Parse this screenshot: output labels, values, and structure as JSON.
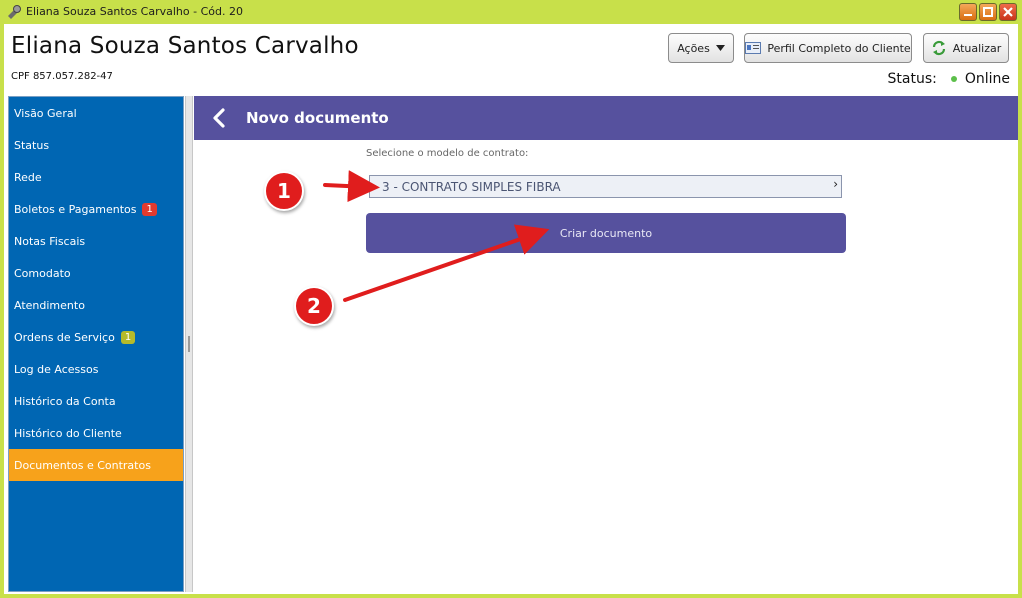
{
  "window": {
    "title": "Eliana Souza Santos Carvalho - Cód. 20",
    "icon": "app-icon",
    "controls": [
      "minimize-icon",
      "maximize-icon",
      "close-icon"
    ]
  },
  "header": {
    "client_name": "Eliana Souza Santos Carvalho",
    "cpf": "CPF 857.057.282-47",
    "actions_label": "Ações",
    "profile_label": "Perfil Completo do Cliente",
    "refresh_label": "Atualizar",
    "status_label": "Status:",
    "status_value": "Online",
    "status_color": "#5cbf4a"
  },
  "sidebar": {
    "items": [
      {
        "label": "Visão Geral"
      },
      {
        "label": "Status"
      },
      {
        "label": "Rede"
      },
      {
        "label": "Boletos e Pagamentos",
        "badge": "1",
        "badge_color": "#e23a2e"
      },
      {
        "label": "Notas Fiscais"
      },
      {
        "label": "Comodato"
      },
      {
        "label": "Atendimento"
      },
      {
        "label": "Ordens de Serviço",
        "badge": "1",
        "badge_color": "#b5ba2a"
      },
      {
        "label": "Log de Acessos"
      },
      {
        "label": "Histórico da Conta"
      },
      {
        "label": "Histórico do Cliente"
      },
      {
        "label": "Documentos e Contratos",
        "active": true
      }
    ],
    "background": "#0066b3",
    "active_color": "#f7a21b"
  },
  "main": {
    "title": "Novo documento",
    "select_label": "Selecione o modelo de contrato:",
    "selected_contract": "3 - CONTRATO SIMPLES FIBRA",
    "create_button": "Criar documento",
    "accent": "#56519e"
  },
  "annotations": {
    "marker_1": "1",
    "marker_2": "2",
    "color": "#e01d1d"
  }
}
